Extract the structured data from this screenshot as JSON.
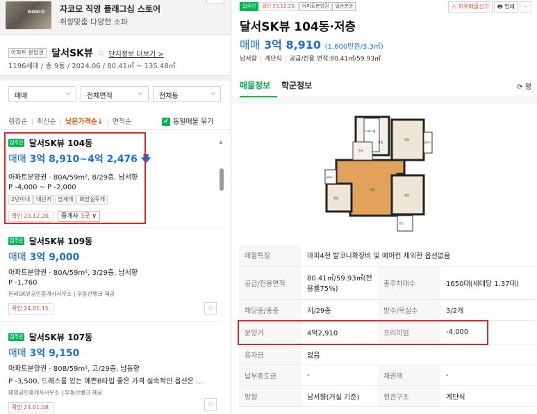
{
  "ad": {
    "brand": "RONIO",
    "title": "자코모 직영 플래그십 스토어",
    "subtitle": "취향맞춤 다양한 소파"
  },
  "complex": {
    "type_chip": "아파트 분양권",
    "name": "달서SK뷰",
    "star": "☆",
    "more_info": "단지정보 더보기 >",
    "meta": "1196세대 / 총 9동 / 2024.06 / 80.41㎡ ~ 135.48㎡"
  },
  "filters": {
    "trade": "매매",
    "area": "전체면적",
    "building": "전체동"
  },
  "sort": {
    "items": [
      "랭킹순",
      "최신순",
      "낮은가격순↓",
      "면적순"
    ],
    "active_index": 2,
    "dedupe_label": "동일매물 묶기",
    "dedupe_checked": true
  },
  "listings": [
    {
      "badge": "집주인",
      "title": "달서SK뷰 104동",
      "price_type": "매매",
      "price": "3억 8,910~4억 2,476",
      "arrow": "🡇",
      "desc": "아파트분양권 · 80A/59m², 8/29층, 남서향",
      "desc2": "P -4,000 ~ P -2,000",
      "tags": [
        "2년이내",
        "대단지",
        "방세개",
        "화장실두개"
      ],
      "confirm": "확인 23.12.20.",
      "agency_prefix": "중개사 ",
      "agency_count": "3곳",
      "agency_suffix": " ∨"
    },
    {
      "badge": "집주인",
      "title": "달서SK뷰 109동",
      "price_type": "매매",
      "price": "3억 9,000",
      "desc": "아파트분양권 · 80A/59m², 3/29층, 남서향",
      "desc2": "P -1,760",
      "agent": "본리SK뷰공인중개사사무소 | 부동산뱅크 제공",
      "confirm": "확인 24.01.15."
    },
    {
      "badge": "집주인",
      "title": "달서SK뷰 107동",
      "price_type": "매매",
      "price": "3억 9,150",
      "desc": "아파트분양권 · 80B/59m², 고/29층, 남동향",
      "desc2": "P -3,500, 드레스룸 있는 예쁜B타입 좋은 가격 실속적인 옵션은 ...",
      "agent": "태영공인중개사사무소 | 부동산뱅크 제공",
      "confirm": "확인 24.01.08."
    }
  ],
  "detail": {
    "chips": [
      "집주인",
      "확인 23.12.23.",
      "아파트분양권",
      "일반분양"
    ],
    "report": "⚠ 허위매물신고",
    "print": "🖶 인쇄",
    "fav": "☆",
    "title": "달서SK뷰 104동·저층",
    "price_type": "매매",
    "price": "3억 8,910",
    "price_unit": "(1,600만원/3.3㎡)",
    "meta": [
      "남서향",
      "계단식",
      "공급/전용 면적:80.41㎡/59.93㎡"
    ],
    "tabs": [
      "매물정보",
      "학군정보"
    ],
    "active_tab": 0,
    "refresh": "⟳ 평",
    "floorplan_labels": [
      "침실",
      "침실",
      "침실",
      "거실",
      "주방",
      "드레스룸",
      "욕실",
      "발코니",
      "현관",
      "발코니"
    ],
    "table": [
      [
        "매물특징",
        "마피4천 발코니확장비 및 에어컨 제외한 옵션없음"
      ],
      [
        "공급/전용면적",
        "80.41㎡/59.93㎡(전용률75%)",
        "총주차대수",
        "1650대(세대당 1.37대)"
      ],
      [
        "해당층/총층",
        "저/29층",
        "방수/욕실수",
        "3/2개"
      ],
      [
        "분양가",
        "4억2,910",
        "프리미엄",
        "-4,000"
      ],
      [
        "융자금",
        "없음"
      ],
      [
        "납부총도금",
        "-",
        "채권액",
        "-"
      ],
      [
        "방향",
        "남서향(거실 기준)",
        "현관구조",
        "계단식"
      ]
    ]
  }
}
